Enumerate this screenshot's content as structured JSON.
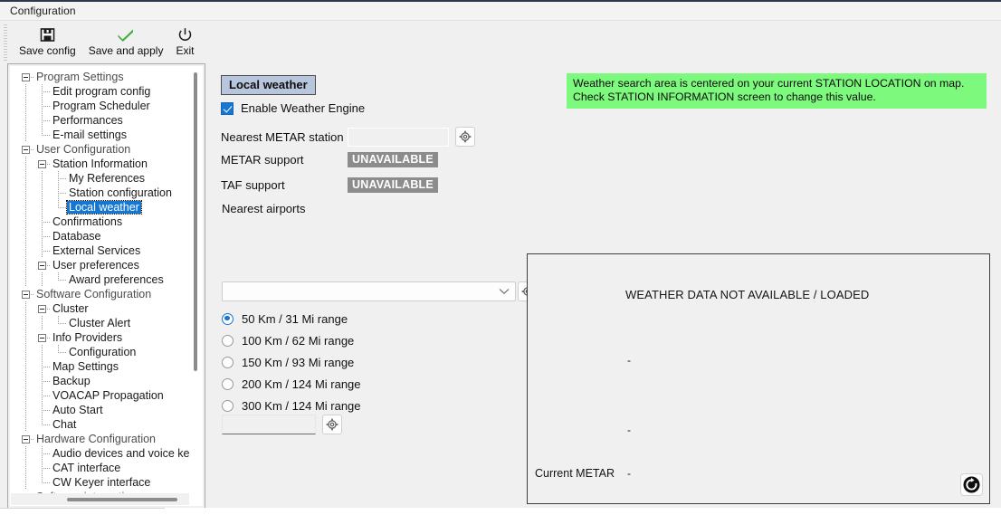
{
  "window": {
    "title": "Configuration"
  },
  "toolbar": {
    "buttons": [
      {
        "label": "Save config",
        "icon": "floppy-disk-icon"
      },
      {
        "label": "Save and apply",
        "icon": "green-check-icon"
      },
      {
        "label": "Exit",
        "icon": "power-icon"
      }
    ]
  },
  "sidebar": {
    "items": [
      {
        "label": "Program Settings",
        "depth": 0,
        "group": true,
        "expander": true
      },
      {
        "label": "Edit program config",
        "depth": 1,
        "group": false,
        "expander": false
      },
      {
        "label": "Program Scheduler",
        "depth": 1,
        "group": false,
        "expander": false
      },
      {
        "label": "Performances",
        "depth": 1,
        "group": false,
        "expander": false
      },
      {
        "label": "E-mail settings",
        "depth": 1,
        "group": false,
        "expander": false,
        "last": true
      },
      {
        "label": "User Configuration",
        "depth": 0,
        "group": true,
        "expander": true
      },
      {
        "label": "Station Information",
        "depth": 1,
        "group": false,
        "expander": true
      },
      {
        "label": "My References",
        "depth": 2,
        "group": false,
        "expander": false
      },
      {
        "label": "Station configuration",
        "depth": 2,
        "group": false,
        "expander": false
      },
      {
        "label": "Local weather",
        "depth": 2,
        "group": false,
        "expander": false,
        "selected": true,
        "last": true
      },
      {
        "label": "Confirmations",
        "depth": 1,
        "group": false,
        "expander": false
      },
      {
        "label": "Database",
        "depth": 1,
        "group": false,
        "expander": false
      },
      {
        "label": "External Services",
        "depth": 1,
        "group": false,
        "expander": false
      },
      {
        "label": "User preferences",
        "depth": 1,
        "group": false,
        "expander": true
      },
      {
        "label": "Award preferences",
        "depth": 2,
        "group": false,
        "expander": false,
        "last": true
      },
      {
        "label": "Software Configuration",
        "depth": 0,
        "group": true,
        "expander": true
      },
      {
        "label": "Cluster",
        "depth": 1,
        "group": false,
        "expander": true
      },
      {
        "label": "Cluster Alert",
        "depth": 2,
        "group": false,
        "expander": false,
        "last": true
      },
      {
        "label": "Info Providers",
        "depth": 1,
        "group": false,
        "expander": true
      },
      {
        "label": "Configuration",
        "depth": 2,
        "group": false,
        "expander": false,
        "last": true
      },
      {
        "label": "Map Settings",
        "depth": 1,
        "group": false,
        "expander": false
      },
      {
        "label": "Backup",
        "depth": 1,
        "group": false,
        "expander": false
      },
      {
        "label": "VOACAP Propagation",
        "depth": 1,
        "group": false,
        "expander": false
      },
      {
        "label": "Auto Start",
        "depth": 1,
        "group": false,
        "expander": false
      },
      {
        "label": "Chat",
        "depth": 1,
        "group": false,
        "expander": false,
        "last": true
      },
      {
        "label": "Hardware Configuration",
        "depth": 0,
        "group": true,
        "expander": true
      },
      {
        "label": "Audio devices and voice keyer",
        "depth": 1,
        "group": false,
        "expander": false
      },
      {
        "label": "CAT interface",
        "depth": 1,
        "group": false,
        "expander": false
      },
      {
        "label": "CW Keyer interface",
        "depth": 1,
        "group": false,
        "expander": false,
        "last": true
      },
      {
        "label": "Software integration",
        "depth": 0,
        "group": true,
        "expander": true
      }
    ]
  },
  "main": {
    "tab_header": "Local weather",
    "notice": {
      "line1": "Weather search area is centered on your current STATION LOCATION on map.",
      "line2": "Check STATION INFORMATION screen to change this value.",
      "bg_color": "#7dfa7d"
    },
    "enable_weather_engine": {
      "label": "Enable Weather Engine",
      "checked": true
    },
    "nearest_metar_station": {
      "label": "Nearest METAR station",
      "value": "",
      "placeholder": "",
      "locate_icon": "target-crosshair-icon"
    },
    "metar_support": {
      "label": "METAR support",
      "status": "UNAVAILABLE"
    },
    "taf_support": {
      "label": "TAF support",
      "status": "UNAVAILABLE"
    },
    "nearest_airports": {
      "label": "Nearest airports",
      "selected": "",
      "dropdown_icon": "chevron-down-icon",
      "locate_icon": "target-crosshair-icon"
    },
    "range_options": [
      {
        "label": "50 Km / 31 Mi range",
        "selected": true
      },
      {
        "label": "100 Km / 62 Mi range",
        "selected": false
      },
      {
        "label": "150 Km / 93 Mi range",
        "selected": false
      },
      {
        "label": "200 Km / 124 Mi range",
        "selected": false
      },
      {
        "label": "300 Km / 124 Mi range",
        "selected": false
      }
    ],
    "custom_range": {
      "value": "",
      "placeholder": "",
      "locate_icon": "target-crosshair-icon"
    },
    "weather_panel": {
      "title": "WEATHER DATA NOT AVAILABLE / LOADED",
      "field1_value": "-",
      "field2_value": "-",
      "current_metar_label": "Current METAR",
      "current_metar_value": "-",
      "refresh_icon": "refresh-icon"
    }
  }
}
